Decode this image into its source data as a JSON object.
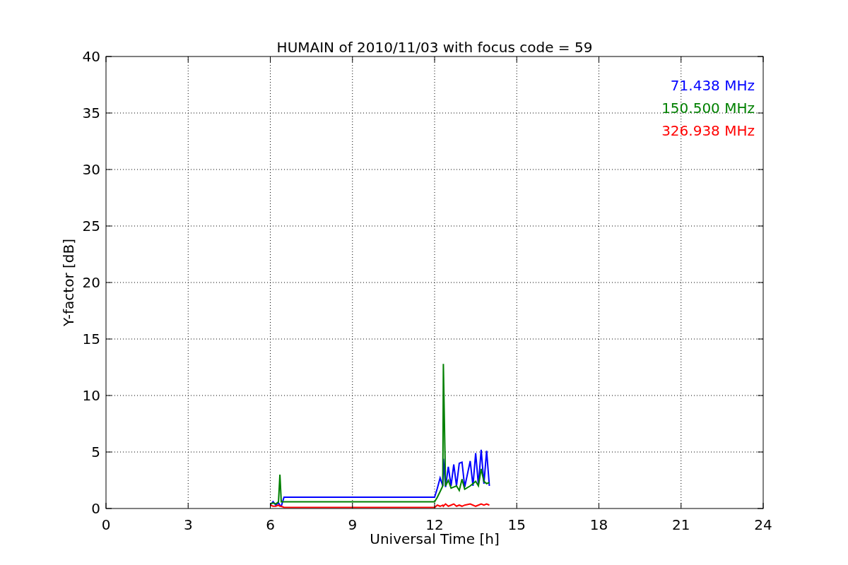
{
  "figure": {
    "chart_data": {
      "type": "line",
      "title": "HUMAIN of 2010/11/03 with focus code = 59",
      "xlabel": "Universal Time [h]",
      "ylabel": "Y-factor [dB]",
      "x": [
        6.0,
        6.1,
        6.2,
        6.3,
        6.35,
        6.4,
        6.5,
        12.0,
        12.1,
        12.2,
        12.3,
        12.32,
        12.4,
        12.5,
        12.6,
        12.7,
        12.8,
        12.9,
        13.0,
        13.1,
        13.3,
        13.4,
        13.5,
        13.6,
        13.7,
        13.8,
        13.9,
        14.0
      ],
      "series": [
        {
          "name": "71.438 MHz",
          "color": "#0000ff",
          "values": [
            0.3,
            0.6,
            0.3,
            0.5,
            0.3,
            0.2,
            1.0,
            1.0,
            1.8,
            2.7,
            2.0,
            4.4,
            1.9,
            3.7,
            2.0,
            3.9,
            2.0,
            4.0,
            4.1,
            1.9,
            4.2,
            2.0,
            4.9,
            2.1,
            5.2,
            2.2,
            5.1,
            2.0
          ]
        },
        {
          "name": "150.500 MHz",
          "color": "#008000",
          "values": [
            0.4,
            0.5,
            0.4,
            0.6,
            3.0,
            0.6,
            0.6,
            0.6,
            1.0,
            1.5,
            2.0,
            12.8,
            2.0,
            2.5,
            1.8,
            1.9,
            2.0,
            1.6,
            2.6,
            1.7,
            2.0,
            2.2,
            2.4,
            2.0,
            3.5,
            2.4,
            2.2,
            2.3
          ]
        },
        {
          "name": "326.938 MHz",
          "color": "#ff0000",
          "values": [
            0.3,
            0.2,
            0.2,
            0.3,
            0.2,
            0.2,
            0.1,
            0.1,
            0.3,
            0.2,
            0.3,
            0.2,
            0.4,
            0.2,
            0.3,
            0.4,
            0.2,
            0.3,
            0.2,
            0.3,
            0.4,
            0.3,
            0.2,
            0.3,
            0.4,
            0.3,
            0.4,
            0.3
          ]
        }
      ],
      "grid": true,
      "xlim": [
        0,
        24
      ],
      "ylim": [
        0,
        40
      ],
      "xticks": [
        0,
        3,
        6,
        9,
        12,
        15,
        18,
        21,
        24
      ],
      "yticks": [
        0,
        5,
        10,
        15,
        20,
        25,
        30,
        35,
        40
      ]
    }
  }
}
